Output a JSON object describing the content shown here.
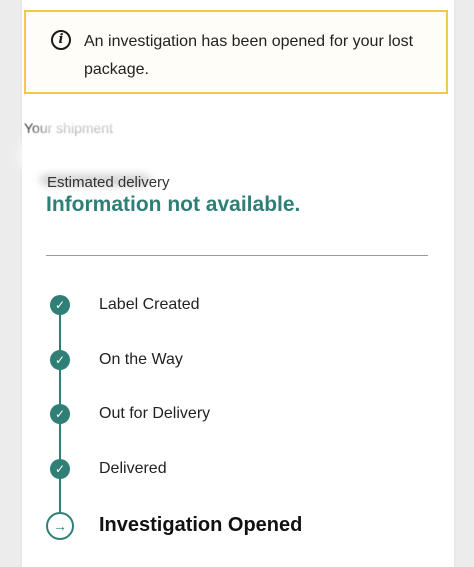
{
  "alert": {
    "icon": "info-icon",
    "icon_glyph": "i",
    "message": "An investigation has been opened for your lost package."
  },
  "shipment": {
    "label": "Your shipment"
  },
  "estimated_delivery": {
    "label": "Estimated delivery",
    "value": "Information not available."
  },
  "timeline": {
    "check_glyph": "✓",
    "arrow_glyph": "→",
    "steps": [
      {
        "label": "Label Created",
        "status": "complete"
      },
      {
        "label": "On the Way",
        "status": "complete"
      },
      {
        "label": "Out for Delivery",
        "status": "complete"
      },
      {
        "label": "Delivered",
        "status": "complete"
      }
    ],
    "current": {
      "label": "Investigation Opened",
      "status": "current"
    }
  },
  "colors": {
    "accent": "#2f7f76",
    "alert_border": "#f2c94c"
  }
}
